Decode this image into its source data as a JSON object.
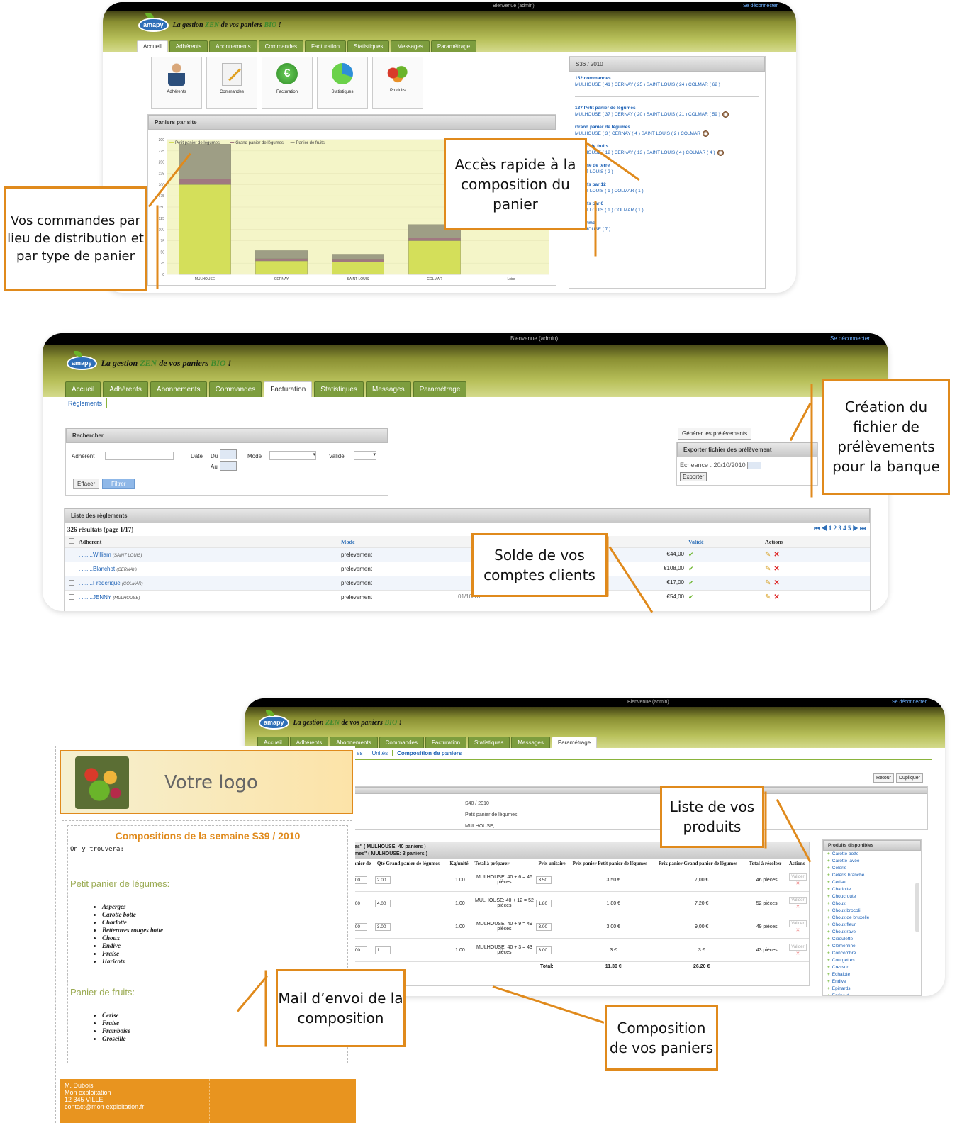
{
  "app": {
    "welcome": "Bienvenue (admin)",
    "logout": "Se déconnecter",
    "logo": "amapy",
    "slogan_pre": "La gestion ",
    "slogan_zen": "ZEN",
    "slogan_mid": " de vos paniers ",
    "slogan_bio": "BIO",
    "slogan_end": " !"
  },
  "tabs": [
    "Accueil",
    "Adhérents",
    "Abonnements",
    "Commandes",
    "Facturation",
    "Statistiques",
    "Messages",
    "Paramétrage"
  ],
  "dashboard": {
    "tiles": [
      "Adhérents",
      "Commandes",
      "Facturation",
      "Statistiques",
      "Produits"
    ],
    "chart_title": "Paniers par site",
    "week": "S36 / 2010",
    "summary": [
      {
        "title": "152 commandes",
        "detail": "MULHOUSE ( 41 )  CERNAY ( 25 )  SAINT LOUIS ( 24 )  COLMAR ( 62 )"
      },
      {
        "title": "137 Petit panier de légumes",
        "detail": "MULHOUSE  ( 37 )  CERNAY  ( 20 )  SAINT LOUIS  ( 21 )  COLMAR  ( 59 )"
      },
      {
        "title": "Grand panier de légumes",
        "detail": "MULHOUSE  ( 3 )  CERNAY  ( 4 )  SAINT LOUIS  ( 2 )  COLMAR"
      },
      {
        "title": "Panier de fruits",
        "detail": "MULHOUSE  ( 12 )  CERNAY  ( 13 )  SAINT LOUIS  ( 4 )  COLMAR  ( 4 )"
      },
      {
        "title": "Pomme de terre",
        "detail": "SAINT LOUIS ( 2 )"
      },
      {
        "title": "2 oeufs par 12",
        "detail": "SAINT LOUIS ( 1 )  COLMAR ( 1 )"
      },
      {
        "title": "2 oeufs par 6",
        "detail": "SAINT LOUIS ( 1 )  COLMAR ( 1 )"
      },
      {
        "title": "7 pomme",
        "detail": "MULHOUSE ( 7 )"
      }
    ]
  },
  "chart_data": {
    "type": "bar",
    "stacked": true,
    "categories": [
      "MULHOUSE",
      "CERNAY",
      "SAINT LOUIS",
      "COLMAR",
      "Loire"
    ],
    "series": [
      {
        "name": "Petit panier de légumes",
        "color": "#d4df5a",
        "values": [
          200,
          30,
          28,
          75,
          0
        ]
      },
      {
        "name": "Grand panier de légumes",
        "color": "#a07880",
        "values": [
          12,
          5,
          5,
          6,
          0
        ]
      },
      {
        "name": "Panier de fruits",
        "color": "#9e9e85",
        "values": [
          78,
          18,
          12,
          30,
          0
        ]
      }
    ],
    "yticks": [
      "300",
      "275",
      "250",
      "225",
      "200",
      "175",
      "150",
      "125",
      "100",
      "75",
      "50",
      "25",
      "0"
    ],
    "ylim": [
      0,
      300
    ]
  },
  "billing": {
    "subtab": "Règlements",
    "search_title": "Rechercher",
    "labels": {
      "member": "Adhérent",
      "date": "Date",
      "from": "Du",
      "to": "Au",
      "mode": "Mode",
      "validated": "Validé"
    },
    "clear": "Effacer",
    "filter": "Filtrer",
    "generate": "Générer les prélèvements",
    "export_title": "Exporter fichier des prélèvement",
    "due_label": "Echeance : ",
    "due": "20/10/2010",
    "export": "Exporter",
    "list_title": "Liste des règlements",
    "results": "326 résultats (page 1/17)",
    "pages": "1 2 3 4 5",
    "columns": [
      "Adherent",
      "Mode",
      "Validé",
      "Actions"
    ],
    "rows": [
      {
        "name": "William",
        "site": "(SAINT LOUIS)",
        "mode": "prelevement",
        "date": "",
        "amount": "€44,00"
      },
      {
        "name": "Blanchot",
        "site": "(CERNAY)",
        "mode": "prelevement",
        "date": "",
        "amount": "€108,00"
      },
      {
        "name": "Frédérique",
        "site": "(COLMAR)",
        "mode": "prelevement",
        "date": "",
        "amount": "€17,00"
      },
      {
        "name": "JENNY",
        "site": "(MULHOUSE)",
        "mode": "prelevement",
        "date": "01/10/10",
        "amount": "€54,00"
      }
    ]
  },
  "compo": {
    "subtabs": [
      "es",
      "Unités",
      "Composition de paniers"
    ],
    "back": "Retour",
    "dup": "Dupliquer",
    "info": [
      "S40 / 2010",
      "Petit panier de légumes",
      "MULHOUSE,"
    ],
    "group_line1": "es\" ( MULHOUSE: 40 paniers )",
    "group_line2": "mes\" ( MULHOUSE: 3 paniers )",
    "columns": [
      "anier de",
      "Qté Grand panier de légumes",
      "Kg/unité",
      "Total à préparer",
      "Prix unitaire",
      "Prix panier Petit panier de légumes",
      "Prix panier Grand panier de légumes",
      "Total à récolter",
      "Actions"
    ],
    "rows": [
      {
        "q1": ".00",
        "q2": "2.00",
        "kg": "1.00",
        "total": "MULHOUSE: 40 + 6 = 46 pièces",
        "price": "3.50",
        "pp": "3,50 €",
        "pg": "7,00 €",
        "rec": "46 pièces"
      },
      {
        "q1": ".00",
        "q2": "4.00",
        "kg": "1.00",
        "total": "MULHOUSE: 40 + 12 = 52 pièces",
        "price": "1.80",
        "pp": "1,80 €",
        "pg": "7,20 €",
        "rec": "52 pièces"
      },
      {
        "q1": ".00",
        "q2": "3.00",
        "kg": "1.00",
        "total": "MULHOUSE: 40 + 9 = 49 pièces",
        "price": "3.00",
        "pp": "3,00 €",
        "pg": "9,00 €",
        "rec": "49 pièces"
      },
      {
        "q1": ".00",
        "q2": "1",
        "kg": "1.00",
        "total": "MULHOUSE: 40 + 3 = 43 pièces",
        "price": "3.00",
        "pp": "3 €",
        "pg": "3 €",
        "rec": "43 pièces"
      }
    ],
    "validate": "Valider",
    "total_label": "Total:",
    "total_small": "11.30 €",
    "total_big": "26.20 €",
    "products_title": "Produits disponibles",
    "products": [
      "Carotte botte",
      "Carotte lavée",
      "Céleris",
      "Céleris branche",
      "Cerise",
      "Charlotte",
      "Choucroute",
      "Choux",
      "Choux brocoli",
      "Choux de bruxelle",
      "Choux fleur",
      "Choux rave",
      "Ciboulette",
      "Clémentine",
      "Concombre",
      "Courgettes",
      "Cresson",
      "Echalote",
      "Endive",
      "Epinards",
      "Farine d"
    ]
  },
  "mail": {
    "logo_text": "Votre logo",
    "title": "Compositions de la semaine S39 / 2010",
    "intro": "On y trouvera:",
    "section1": "Petit panier de légumes:",
    "items1": [
      "Asperges",
      "Carotte botte",
      "Charlotte",
      "Betteraves rouges botte",
      "Choux",
      "Endive",
      "Fraise",
      "Haricots"
    ],
    "section2": "Panier de fruits:",
    "items2": [
      "Cerise",
      "Fraise",
      "Framboise",
      "Groseille"
    ],
    "footer": [
      "M. Dubois",
      "Mon exploitation",
      "12 345 VILLE",
      "contact@mon-exploitation.fr"
    ]
  },
  "callouts": {
    "orders": "Vos commandes par lieu de distribution et par type de panier",
    "quick": "Accès rapide à la composition du panier",
    "bank": "Création du fichier de prélèvements pour la banque",
    "balance": "Solde de vos comptes clients",
    "products": "Liste de vos produits",
    "mail": "Mail d’envoi de la composition",
    "baskets": "Composition de vos paniers"
  },
  "colors": {
    "accent": "#e08a1c",
    "tab": "#7d9d3e",
    "link": "#1a5fb4",
    "chart_bg": "#f4f5c8"
  }
}
